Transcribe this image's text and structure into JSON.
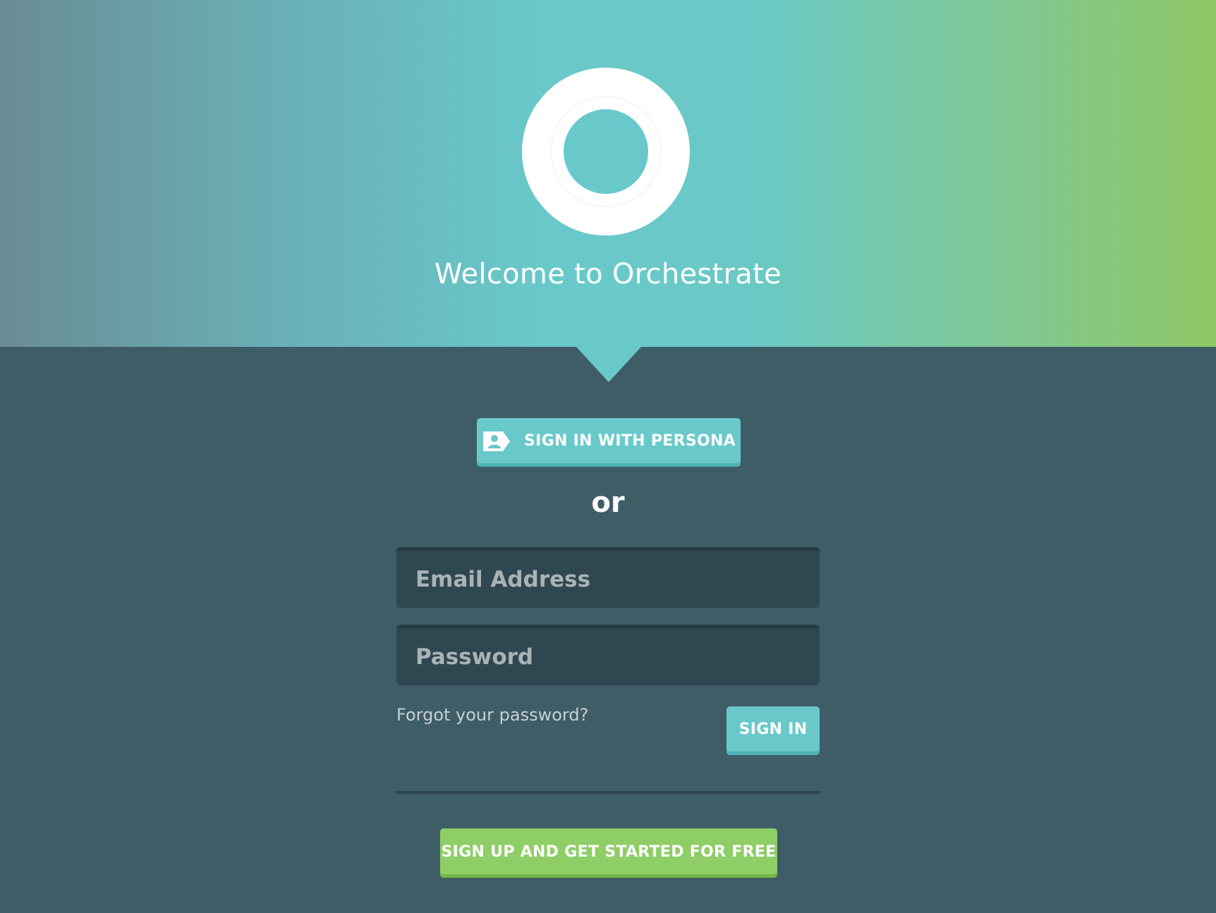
{
  "header": {
    "title": "Welcome to Orchestrate",
    "logo_icon": "ring-logo-icon"
  },
  "persona": {
    "label": "SIGN IN WITH PERSONA",
    "icon": "persona-id-card-icon"
  },
  "separator_text": "or",
  "form": {
    "email": {
      "placeholder": "Email Address",
      "value": ""
    },
    "password": {
      "placeholder": "Password",
      "value": ""
    },
    "forgot_label": "Forgot your password?",
    "signin_label": "SIGN IN"
  },
  "signup": {
    "label": "SIGN UP AND GET STARTED FOR FREE"
  },
  "colors": {
    "background": "#3e5d67",
    "accent_teal": "#69c9ca",
    "accent_green": "#8fce66",
    "field_bg": "#2f4750"
  }
}
